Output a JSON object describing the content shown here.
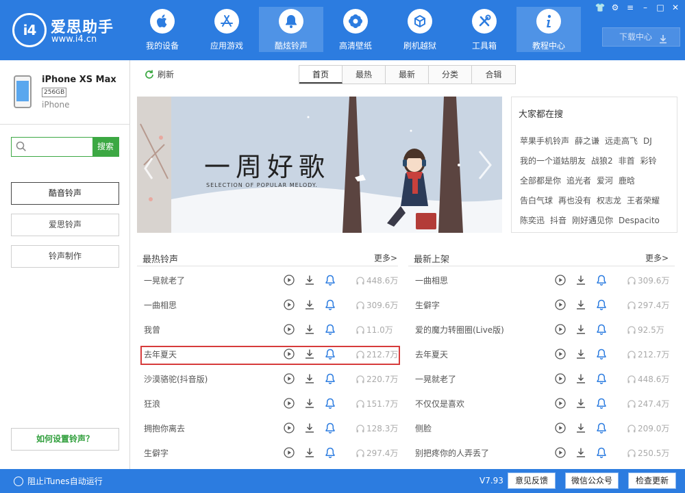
{
  "app": {
    "logo_text": "i4",
    "name": "爱思助手",
    "url": "www.i4.cn"
  },
  "nav": [
    {
      "label": "我的设备",
      "icon": "apple-icon",
      "active": false
    },
    {
      "label": "应用游戏",
      "icon": "app-store-icon",
      "active": false
    },
    {
      "label": "酷炫铃声",
      "icon": "bell-icon",
      "active": true
    },
    {
      "label": "高清壁纸",
      "icon": "flower-icon",
      "active": false
    },
    {
      "label": "刷机越狱",
      "icon": "box-icon",
      "active": false
    },
    {
      "label": "工具箱",
      "icon": "tools-icon",
      "active": false
    },
    {
      "label": "教程中心",
      "icon": "info-icon",
      "active": false
    }
  ],
  "download_center": "下载中心",
  "device": {
    "name": "iPhone XS Max",
    "capacity": "256GB",
    "type": "iPhone"
  },
  "search": {
    "placeholder": "",
    "button": "搜索"
  },
  "side_menu": [
    {
      "label": "酷音铃声",
      "active": true
    },
    {
      "label": "爱思铃声",
      "active": false
    },
    {
      "label": "铃声制作",
      "active": false
    }
  ],
  "howto": "如何设置铃声？",
  "refresh": "刷新",
  "tabs": [
    {
      "label": "首页",
      "active": true
    },
    {
      "label": "最热",
      "active": false
    },
    {
      "label": "最新",
      "active": false
    },
    {
      "label": "分类",
      "active": false
    },
    {
      "label": "合辑",
      "active": false
    }
  ],
  "banner": {
    "title": "一周好歌",
    "subtitle": "SELECTION OF POPULAR MELODY."
  },
  "hot_search": {
    "title": "大家都在搜",
    "rows": [
      [
        "苹果手机铃声",
        "薛之谦",
        "远走高飞",
        "DJ"
      ],
      [
        "我的一个道姑朋友",
        "战狼2",
        "非首",
        "彩铃"
      ],
      [
        "全部都是你",
        "追光者",
        "爱河",
        "鹿晗"
      ],
      [
        "告白气球",
        "再也没有",
        "权志龙",
        "王者荣耀"
      ],
      [
        "陈奕迅",
        "抖音",
        "刚好遇见你",
        "Despacito"
      ]
    ]
  },
  "hot_list": {
    "title": "最热铃声",
    "more": "更多>",
    "items": [
      {
        "name": "一晃就老了",
        "plays": "448.6万"
      },
      {
        "name": "一曲相思",
        "plays": "309.6万"
      },
      {
        "name": "我曾",
        "plays": "11.0万"
      },
      {
        "name": "去年夏天",
        "plays": "212.7万"
      },
      {
        "name": "沙漠骆驼(抖音版)",
        "plays": "220.7万"
      },
      {
        "name": "狂浪",
        "plays": "151.7万"
      },
      {
        "name": "拥抱你离去",
        "plays": "128.3万"
      },
      {
        "name": "生僻字",
        "plays": "297.4万"
      }
    ]
  },
  "new_list": {
    "title": "最新上架",
    "more": "更多>",
    "items": [
      {
        "name": "一曲相思",
        "plays": "309.6万"
      },
      {
        "name": "生僻字",
        "plays": "297.4万"
      },
      {
        "name": "爱的魔力转圈圈(Live版)",
        "plays": "92.5万"
      },
      {
        "name": "去年夏天",
        "plays": "212.7万"
      },
      {
        "name": "一晃就老了",
        "plays": "448.6万"
      },
      {
        "name": "不仅仅是喜欢",
        "plays": "247.4万"
      },
      {
        "name": "侧脸",
        "plays": "209.0万"
      },
      {
        "name": "别把疼你的人弄丢了",
        "plays": "250.5万"
      }
    ]
  },
  "status": {
    "itunes": "阻止iTunes自动运行",
    "version": "V7.93",
    "feedback": "意见反馈",
    "wechat": "微信公众号",
    "update": "检查更新"
  },
  "colors": {
    "brand_blue": "#2c7ce0",
    "search_green": "#3ca843",
    "highlight_red": "#d63a3a",
    "icon_blue": "#2c7ce0"
  }
}
